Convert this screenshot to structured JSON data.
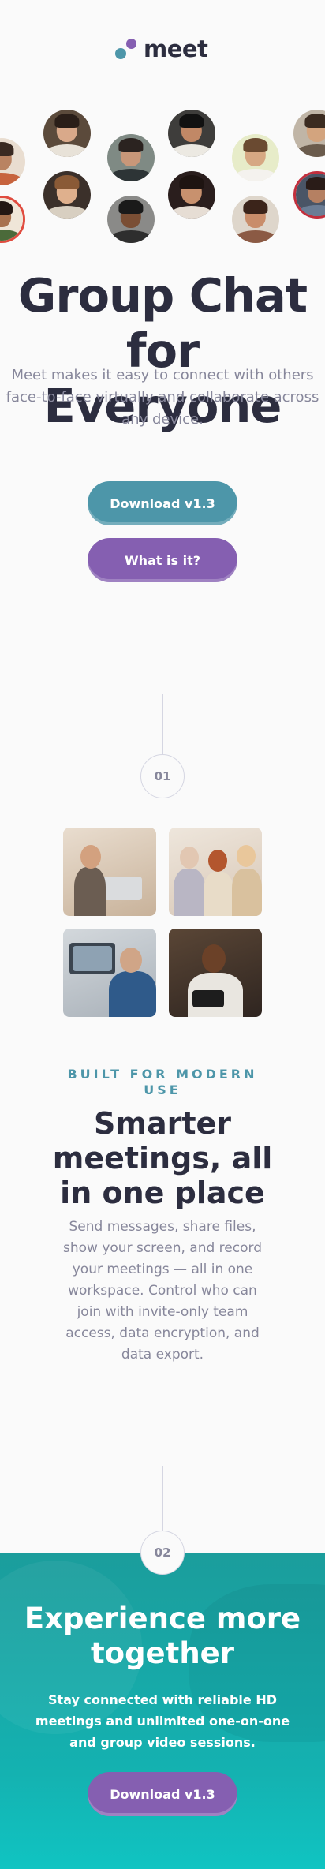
{
  "brand": {
    "logo_text": "meet",
    "colors": {
      "teal": "#4d96a9",
      "purple": "#855fb1",
      "dark": "#2c2d3f",
      "gray": "#87879b"
    }
  },
  "hero": {
    "title": "Group Chat for Everyone",
    "text": "Meet makes it easy to connect with others face-to-face virtually and collaborate across any device.",
    "download_label": "Download v1.3",
    "what_label": "What is it?"
  },
  "steps": {
    "first": "01",
    "second": "02"
  },
  "features": {
    "eyebrow": "BUILT FOR MODERN USE",
    "title": "Smarter meetings, all in one place",
    "text": "Send messages, share files, show your screen, and record your meetings — all in one workspace. Control who can join with invite-only team access, data encryption, and data export."
  },
  "cta": {
    "title": "Experience more together",
    "text": "Stay connected with reliable HD meetings and unlimited one-on-one and group video sessions.",
    "download_label": "Download v1.3"
  }
}
